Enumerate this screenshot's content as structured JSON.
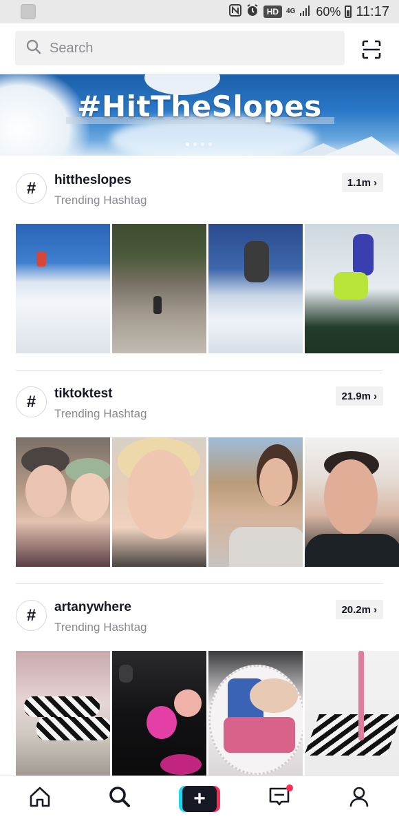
{
  "status_bar": {
    "network_badge": "HD",
    "network_type": "4G",
    "battery": "60%",
    "time": "11:17"
  },
  "search": {
    "placeholder": "Search"
  },
  "banner": {
    "title": "#HitTheSlopes"
  },
  "sections": [
    {
      "hash": "#",
      "name": "hittheslopes",
      "subtitle": "Trending Hashtag",
      "count": "1.1m"
    },
    {
      "hash": "#",
      "name": "tiktoktest",
      "subtitle": "Trending Hashtag",
      "count": "21.9m"
    },
    {
      "hash": "#",
      "name": "artanywhere",
      "subtitle": "Trending Hashtag",
      "count": "20.2m"
    }
  ],
  "bottom_nav": {
    "create_symbol": "+"
  },
  "colors": {
    "accent_red": "#fe2c55",
    "accent_cyan": "#20d5ec",
    "text_primary": "#161823",
    "text_secondary": "#8a8b91"
  }
}
